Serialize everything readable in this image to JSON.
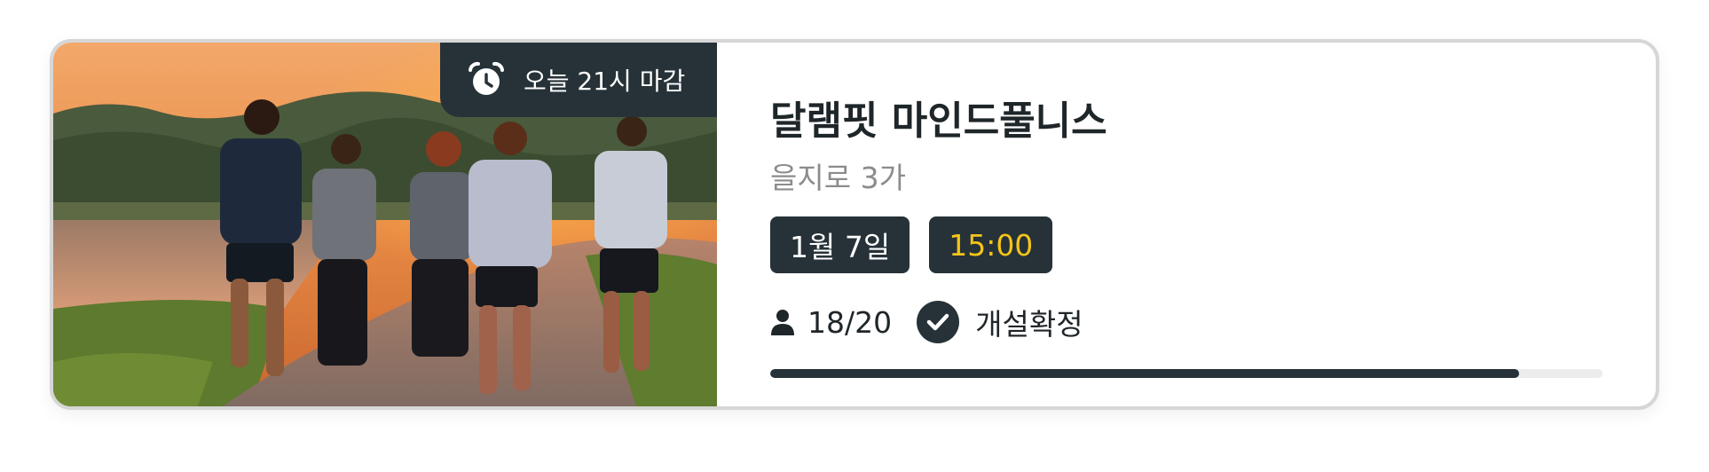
{
  "event": {
    "deadline_label": "오늘 21시 마감",
    "title": "달램핏 마인드풀니스",
    "location": "을지로 3가",
    "date": "1월 7일",
    "time": "15:00",
    "participants": "18/20",
    "progress": 0.9,
    "status": "개설확정"
  },
  "icons": {
    "deadline": "alarm-clock-icon",
    "participants": "person-icon",
    "status": "check-circle-icon"
  },
  "colors": {
    "chip_bg": "#263238",
    "time_text": "#f5c518",
    "progress_fill": "#263238",
    "progress_track": "#ececec"
  }
}
